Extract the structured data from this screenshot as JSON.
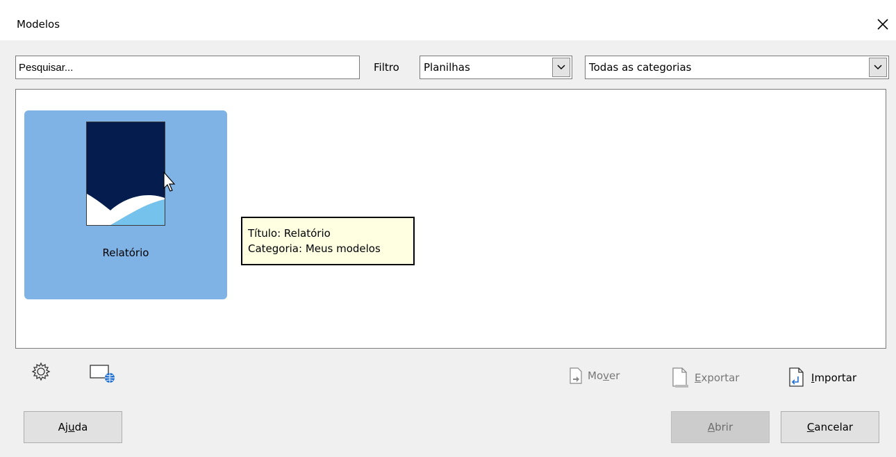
{
  "window": {
    "title": "Modelos"
  },
  "toolbar": {
    "search_placeholder": "Pesquisar...",
    "filter_label": "Filtro",
    "filter_value": "Planilhas",
    "category_value": "Todas as categorias"
  },
  "templates": [
    {
      "label": "Relatório"
    }
  ],
  "tooltip": {
    "line1": "Título: Relatório",
    "line2": "Categoria: Meus modelos"
  },
  "actions": {
    "move_pre": "Mo",
    "move_u": "v",
    "move_post": "er",
    "export_u": "E",
    "export_post": "xportar",
    "import_u": "I",
    "import_post": "mportar"
  },
  "buttons": {
    "help_pre": "Aj",
    "help_u": "u",
    "help_post": "da",
    "open_u": "A",
    "open_post": "brir",
    "cancel_u": "C",
    "cancel_post": "ancelar"
  },
  "icons": {
    "close": "close-icon",
    "settings": "gear-icon",
    "online": "online-templates-icon",
    "move": "move-icon",
    "export": "export-icon",
    "import": "import-icon",
    "dropdown": "chevron-down-icon"
  },
  "colors": {
    "selection": "#7fb3e6",
    "thumb_navy": "#041d4e",
    "thumb_light_blue": "#75c2ec",
    "tooltip_bg": "#ffffe1"
  }
}
